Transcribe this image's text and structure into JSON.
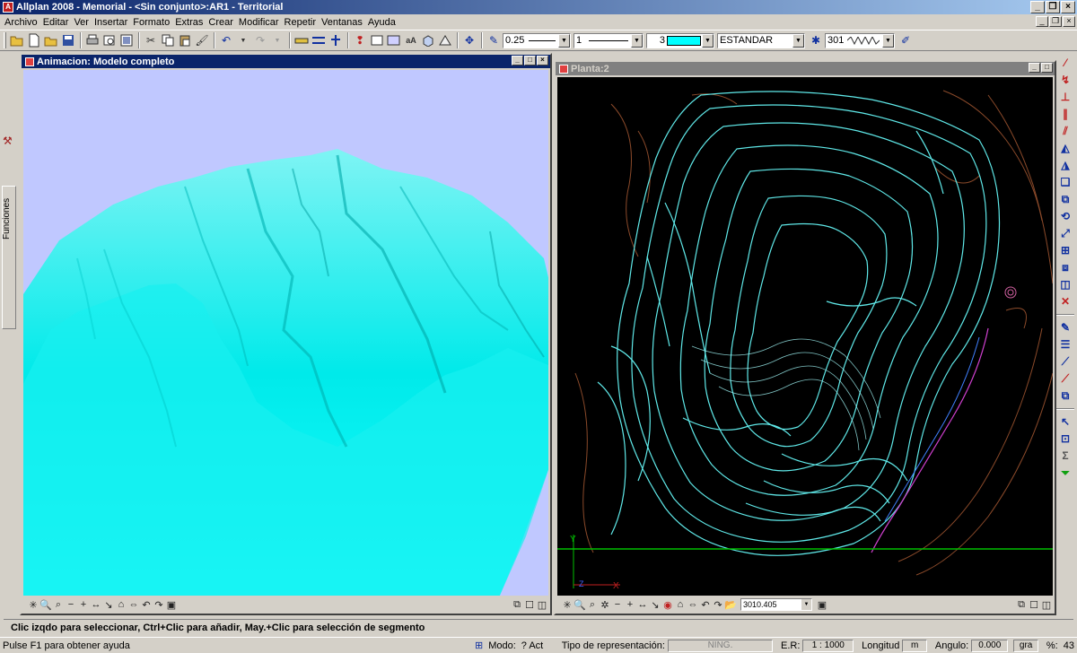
{
  "app": {
    "title": "Allplan 2008 - Memorial - <Sin conjunto>:AR1 - Territorial",
    "icon_name": "allplan-icon"
  },
  "menu": [
    "Archivo",
    "Editar",
    "Ver",
    "Insertar",
    "Formato",
    "Extras",
    "Crear",
    "Modificar",
    "Repetir",
    "Ventanas",
    "Ayuda"
  ],
  "toolbar": {
    "pen_thickness": "0.25",
    "line_type": "1",
    "color_number": "3",
    "color_swatch": "#00ffff",
    "layer": "ESTANDAR",
    "pattern": "301"
  },
  "left_panel": {
    "label": "Funciones"
  },
  "window_animation": {
    "caption": "Animacion: Modelo completo",
    "background": "#c0c8ff"
  },
  "window_plan": {
    "caption": "Planta:2",
    "coord_value": "3010.405",
    "background": "#000000"
  },
  "dialog_line": "Clic izqdo para seleccionar, Ctrl+Clic para añadir, May.+Clic para selección de segmento",
  "statusbar": {
    "help": "Pulse F1 para obtener ayuda",
    "mode_label": "Modo:",
    "mode_value": "? Act",
    "repr_label": "Tipo de representación:",
    "repr_value": "NING.",
    "scale_label": "E.R:",
    "scale_value": "1 : 1000",
    "length_label": "Longitud",
    "length_value": "m",
    "angle_label": "Angulo:",
    "angle_value": "0.000",
    "angle_unit": "gra",
    "percent_label": "%:",
    "percent_value": "43"
  },
  "colors": {
    "active_caption": "#0a246a",
    "terrain": "#00ffff",
    "contour_cyan": "#5fe8e8",
    "contour_brown": "#8b4a2a",
    "axis_green": "#00c000"
  }
}
